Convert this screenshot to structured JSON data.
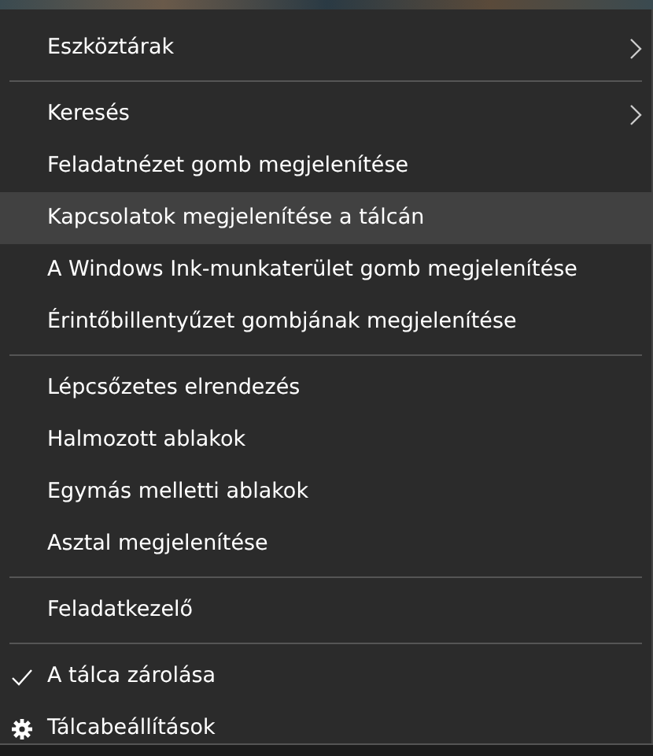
{
  "menu": {
    "sections": [
      [
        {
          "label": "Eszköztárak",
          "kind": "submenu",
          "selected": false,
          "checked": false
        }
      ],
      [
        {
          "label": "Keresés",
          "kind": "submenu",
          "selected": false,
          "checked": false
        },
        {
          "label": "Feladatnézet gomb megjelenítése",
          "kind": "item",
          "selected": false,
          "checked": false
        },
        {
          "label": "Kapcsolatok megjelenítése a tálcán",
          "kind": "item",
          "selected": true,
          "checked": false
        },
        {
          "label": "A Windows Ink-munkaterület gomb megjelenítése",
          "kind": "item",
          "selected": false,
          "checked": false
        },
        {
          "label": "Érintőbillentyűzet gombjának megjelenítése",
          "kind": "item",
          "selected": false,
          "checked": false
        }
      ],
      [
        {
          "label": "Lépcsőzetes elrendezés",
          "kind": "item",
          "selected": false,
          "checked": false
        },
        {
          "label": "Halmozott ablakok",
          "kind": "item",
          "selected": false,
          "checked": false
        },
        {
          "label": "Egymás melletti ablakok",
          "kind": "item",
          "selected": false,
          "checked": false
        },
        {
          "label": "Asztal megjelenítése",
          "kind": "item",
          "selected": false,
          "checked": false
        }
      ],
      [
        {
          "label": "Feladatkezelő",
          "kind": "item",
          "selected": false,
          "checked": false
        }
      ],
      [
        {
          "label": "A tálca zárolása",
          "kind": "item",
          "selected": false,
          "checked": true
        },
        {
          "label": "Tálcabeállítások",
          "kind": "settings",
          "selected": false,
          "checked": false
        }
      ]
    ]
  }
}
